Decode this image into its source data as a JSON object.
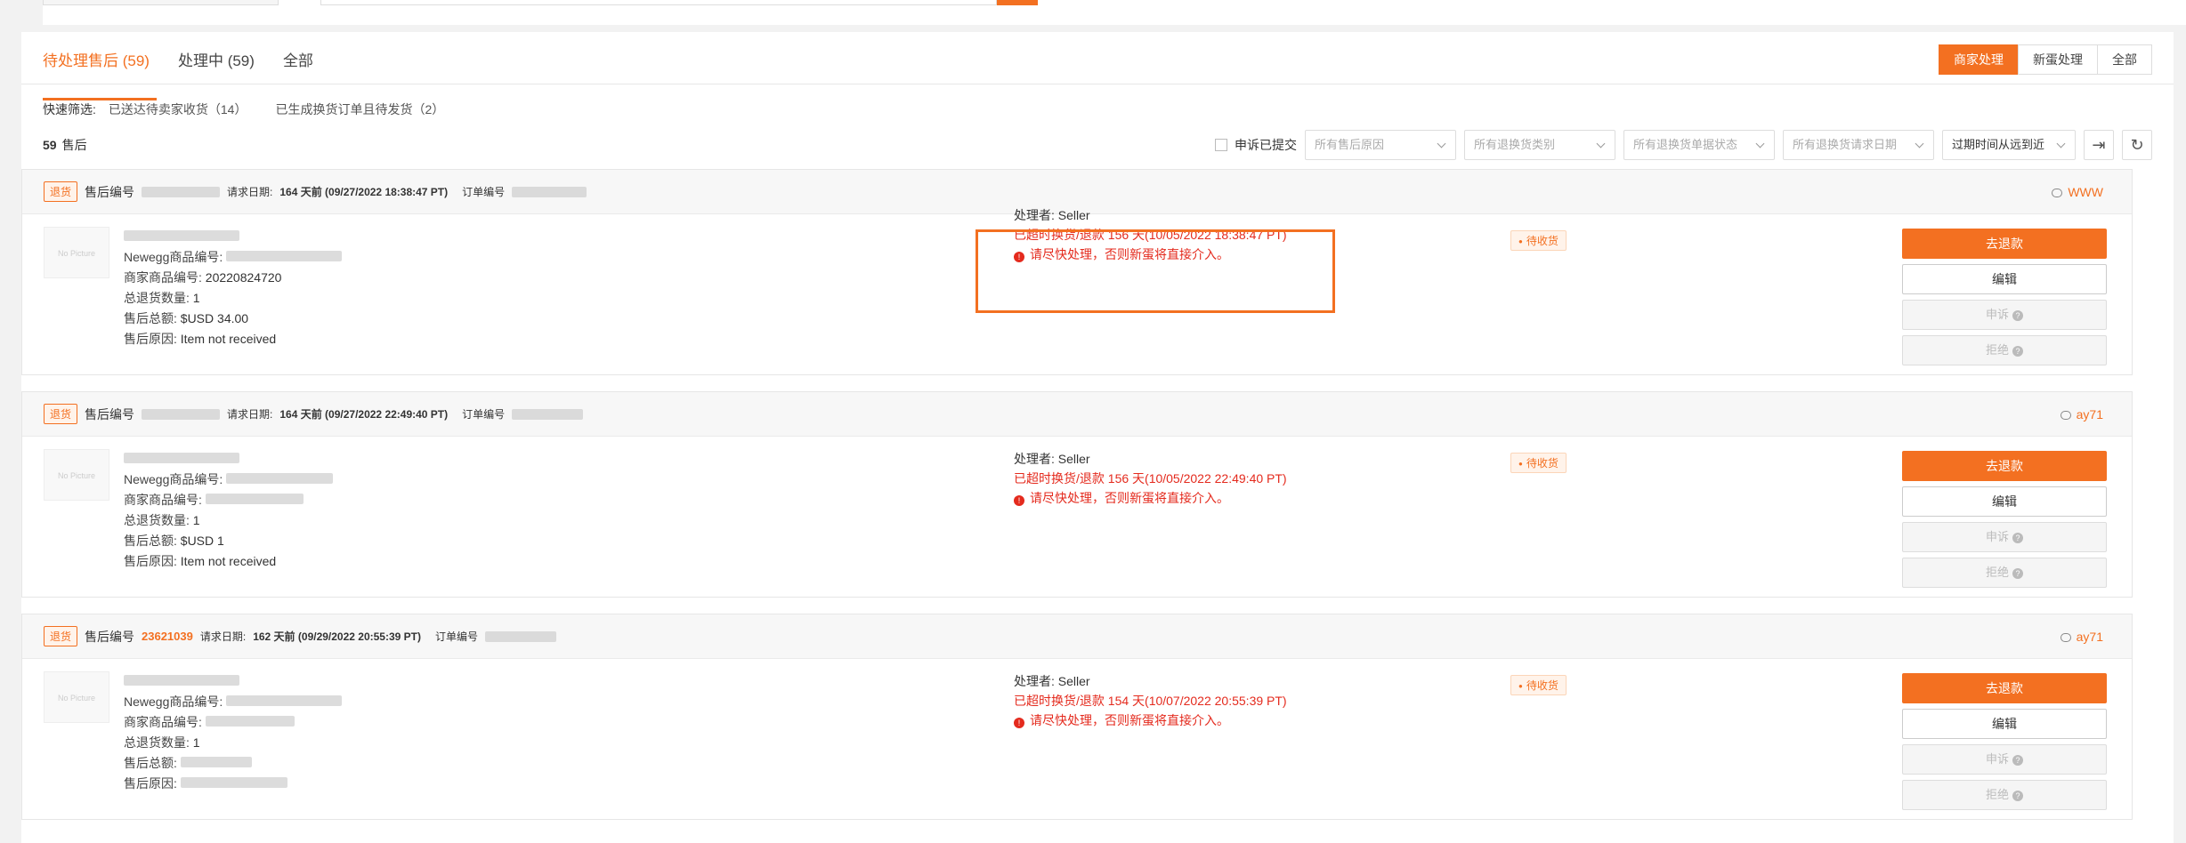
{
  "tabs": [
    {
      "label": "待处理售后 (59)"
    },
    {
      "label": "处理中 (59)"
    },
    {
      "label": "全部"
    }
  ],
  "segment": [
    "商家处理",
    "新蛋处理",
    "全部"
  ],
  "quick_filter": {
    "label": "快速筛选:",
    "items": [
      "已送达待卖家收货（14）",
      "已生成换货订单且待发货（2）"
    ]
  },
  "total": {
    "count": "59",
    "label": "售后"
  },
  "filters": {
    "appeal_checkbox": "申诉已提交",
    "reason": "所有售后原因",
    "type": "所有退换货类别",
    "status": "所有退换货单据状态",
    "date": "所有退换货请求日期",
    "sort": "过期时间从远到近"
  },
  "labels": {
    "tag": "退货",
    "rma_no": "售后编号",
    "req_date": "请求日期:",
    "order_no": "订单编号",
    "newegg_item": "Newegg商品编号:",
    "seller_item": "商家商品编号:",
    "qty": "总退货数量:",
    "total": "售后总额:",
    "reason": "售后原因:",
    "handler": "处理者:",
    "no_picture": "No Picture",
    "urgent": "请尽快处理，否则新蛋将直接介入。"
  },
  "cards": [
    {
      "rma_no": "",
      "req_date": "164 天前 (09/27/2022 18:38:47 PT)",
      "customer": "WWW",
      "seller_item": "20220824720",
      "qty": "1",
      "currency": "$USD",
      "amount": "34.00",
      "reason": "Item not received",
      "handler": "Seller",
      "overdue": "已超时换货/退款 156 天(10/05/2022 18:38:47 PT)",
      "status": "待收货",
      "actions": [
        "去退款",
        "编辑",
        "申诉",
        "拒绝"
      ]
    },
    {
      "rma_no": "",
      "req_date": "164 天前 (09/27/2022 22:49:40 PT)",
      "customer": "ay71",
      "seller_item": "",
      "qty": "1",
      "currency": "$USD",
      "amount": "1",
      "reason": "Item not received",
      "handler": "Seller",
      "overdue": "已超时换货/退款 156 天(10/05/2022 22:49:40 PT)",
      "status": "待收货",
      "actions": [
        "去退款",
        "编辑",
        "申诉",
        "拒绝"
      ]
    },
    {
      "rma_no": "23621039",
      "req_date": "162 天前 (09/29/2022 20:55:39 PT)",
      "customer": "ay71",
      "seller_item": "",
      "qty": "1",
      "currency": "",
      "amount": "",
      "reason": "",
      "handler": "Seller",
      "overdue": "已超时换货/退款 154 天(10/07/2022 20:55:39 PT)",
      "status": "待收货",
      "actions": [
        "去退款",
        "编辑",
        "申诉",
        "拒绝"
      ]
    }
  ]
}
